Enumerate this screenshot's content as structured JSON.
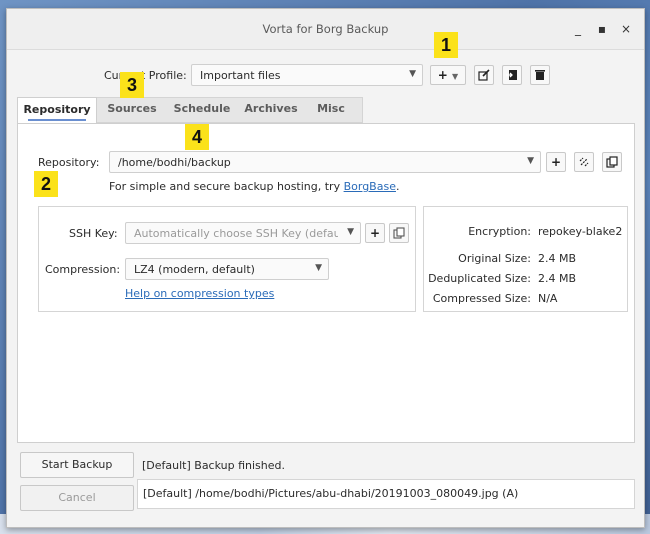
{
  "window": {
    "title": "Vorta for Borg Backup",
    "controls": {
      "minimize": "_",
      "maximize": "▪",
      "close": "×"
    }
  },
  "profile": {
    "label": "Current Profile:",
    "value": "Important files",
    "buttons": [
      "add-profile-icon",
      "edit-icon",
      "export-icon",
      "delete-icon"
    ]
  },
  "tabs": [
    {
      "label": "Repository",
      "active": true
    },
    {
      "label": "Sources",
      "active": false
    },
    {
      "label": "Schedule",
      "active": false
    },
    {
      "label": "Archives",
      "active": false
    },
    {
      "label": "Misc",
      "active": false
    }
  ],
  "repository": {
    "label": "Repository:",
    "value": "/home/bodhi/backup",
    "hint_prefix": "For simple and secure backup hosting, try ",
    "hint_link": "BorgBase",
    "hint_suffix": "."
  },
  "ssh": {
    "label": "SSH Key:",
    "value": "Automatically choose SSH Key (default)"
  },
  "compression": {
    "label": "Compression:",
    "value": "LZ4 (modern, default)",
    "help_link": "Help on compression types"
  },
  "stats": [
    {
      "label": "Encryption:",
      "value": "repokey-blake2"
    },
    {
      "label": "Original Size:",
      "value": "2.4 MB"
    },
    {
      "label": "Deduplicated Size:",
      "value": "2.4 MB"
    },
    {
      "label": "Compressed Size:",
      "value": "N/A"
    }
  ],
  "actions": {
    "start": "Start Backup",
    "cancel": "Cancel",
    "status1": "[Default] Backup finished.",
    "status2": "[Default] /home/bodhi/Pictures/abu-dhabi/20191003_080049.jpg (A)"
  },
  "markers": [
    "1",
    "2",
    "3",
    "4"
  ],
  "colors": {
    "accent": "#6a8fd0",
    "marker": "#fbe21a",
    "link": "#2a6bb8"
  }
}
